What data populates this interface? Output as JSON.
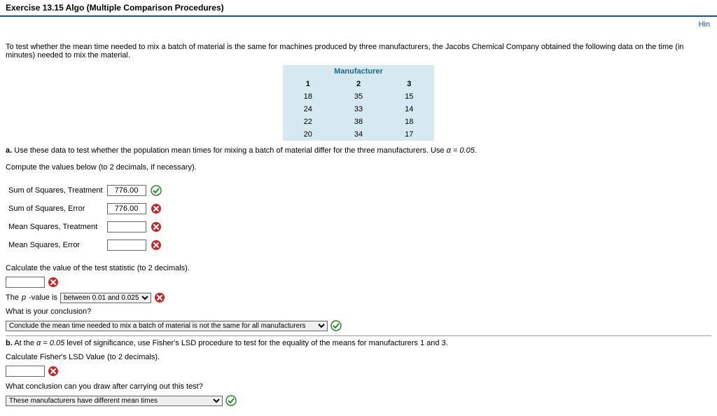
{
  "header": {
    "title": "Exercise 13.15 Algo (Multiple Comparison Procedures)"
  },
  "hint": {
    "label": "Hin"
  },
  "intro": "To test whether the mean time needed to mix a batch of material is the same for machines produced by three manufacturers, the Jacobs Chemical Company obtained the following data on the time (in minutes) needed to mix the material.",
  "table": {
    "super_header": "Manufacturer",
    "cols": [
      "1",
      "2",
      "3"
    ],
    "rows": [
      [
        "18",
        "35",
        "15"
      ],
      [
        "24",
        "33",
        "14"
      ],
      [
        "22",
        "38",
        "18"
      ],
      [
        "20",
        "34",
        "17"
      ]
    ]
  },
  "part_a": {
    "label": "a.",
    "text_prefix": "Use these data to test whether the population mean times for mixing a batch of material differ for the three manufacturers. Use ",
    "alpha_eq": "α = 0.05",
    "period": ".",
    "compute_intro": "Compute the values below (to 2 decimals, if necessary).",
    "fields": [
      {
        "label": "Sum of Squares, Treatment",
        "value": "776.00",
        "status": "correct"
      },
      {
        "label": "Sum of Squares, Error",
        "value": "776.00",
        "status": "wrong"
      },
      {
        "label": "Mean Squares, Treatment",
        "value": "",
        "status": "wrong"
      },
      {
        "label": "Mean Squares, Error",
        "value": "",
        "status": "wrong"
      }
    ],
    "test_stat_label": "Calculate the value of the test statistic (to 2 decimals).",
    "test_stat_value": "",
    "test_stat_status": "wrong",
    "pvalue_prefix": "The ",
    "pvalue_var": "p",
    "pvalue_mid": "-value is",
    "pvalue_selected": "between 0.01 and 0.025",
    "pvalue_status": "wrong",
    "conclusion_q": "What is your conclusion?",
    "conclusion_selected": "Conclude the mean time needed to mix a batch of material is not the same for all manufacturers",
    "conclusion_status": "correct"
  },
  "part_b": {
    "label": "b.",
    "text_prefix": "At the ",
    "alpha_eq": "α = 0.05",
    "text_suffix": " level of significance, use Fisher's LSD procedure to test for the equality of the means for manufacturers 1 and 3.",
    "lsd_label": "Calculate Fisher's LSD Value (to 2 decimals).",
    "lsd_value": "",
    "lsd_status": "wrong",
    "conclusion_q": "What conclusion can you draw after carrying out this test?",
    "conclusion_selected": "These manufacturers have different mean times",
    "conclusion_status": "correct"
  },
  "chart_data": {
    "type": "table",
    "title": "Manufacturer",
    "categories": [
      "1",
      "2",
      "3"
    ],
    "series": [
      {
        "name": "row1",
        "values": [
          18,
          35,
          15
        ]
      },
      {
        "name": "row2",
        "values": [
          24,
          33,
          14
        ]
      },
      {
        "name": "row3",
        "values": [
          22,
          38,
          18
        ]
      },
      {
        "name": "row4",
        "values": [
          20,
          34,
          17
        ]
      }
    ]
  }
}
